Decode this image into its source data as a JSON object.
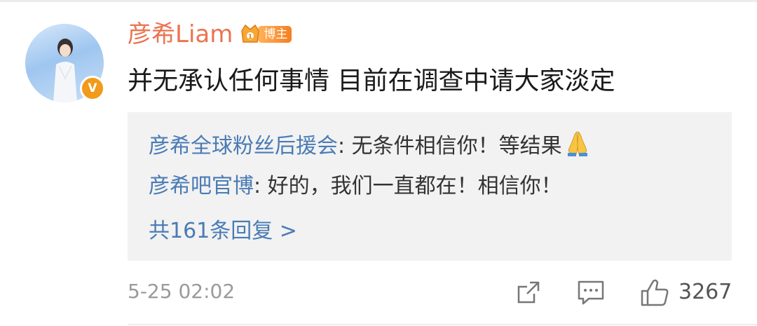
{
  "comment": {
    "username": "彦希Liam",
    "badge_label": "博主",
    "verified_mark": "V",
    "text": "并无承认任何事情 目前在调查中请大家淡定",
    "timestamp": "5-25 02:02",
    "like_count": "3267"
  },
  "replies": [
    {
      "author": "彦希全球粉丝后援会",
      "separator": ":",
      "text": " 无条件相信你！等结果"
    },
    {
      "author": "彦希吧官博",
      "separator": ":",
      "text": " 好的，我们一直都在！相信你！"
    }
  ],
  "view_more": "共161条回复 >",
  "icons": {
    "verified": "verified-v-icon",
    "crown": "crown-icon",
    "pray": "pray-emoji",
    "share": "share-icon",
    "reply": "comment-icon",
    "like": "thumbs-up-icon"
  },
  "colors": {
    "username": "#eb7350",
    "link": "#4a7bb5",
    "badge": "#f57f21",
    "verified": "#f29a1a",
    "reply_bg": "#f2f2f2"
  }
}
